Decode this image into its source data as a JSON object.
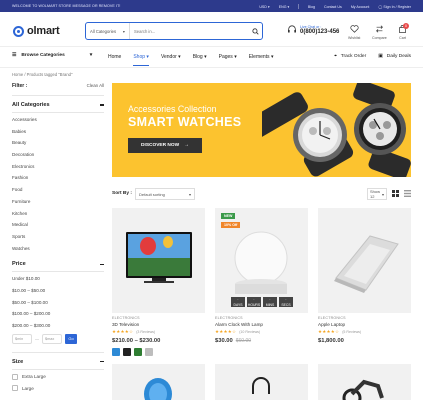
{
  "topbar": {
    "welcome": "WELCOME TO WOLMART STORE MESSAGE OR REMOVE IT!",
    "currency": "USD",
    "language": "ENG",
    "links": [
      "Blog",
      "Contact Us",
      "My Account"
    ],
    "signin": "Sign In / Register"
  },
  "header": {
    "logo": "olmart",
    "search": {
      "category": "All Categories",
      "placeholder": "Search in..."
    },
    "live_chat": "Live Chat or :",
    "phone": "0(800)123-456",
    "wishlist": "Wishlist",
    "compare": "Compare",
    "cart": "Cart",
    "cart_count": "0"
  },
  "nav": {
    "browse": "Browse Categories",
    "items": [
      "Home",
      "Shop",
      "Vendor",
      "Blog",
      "Pages",
      "Elements"
    ],
    "track_order": "Track Order",
    "daily_deals": "Daily Deals"
  },
  "breadcrumb": "Home  /  Products tagged \"Brand\"",
  "sidebar": {
    "filter": "Filter :",
    "clear_all": "Clean All",
    "categories_title": "All Categories",
    "categories": [
      "Accessories",
      "Babies",
      "Beauty",
      "Decoration",
      "Electronics",
      "Fashion",
      "Food",
      "Furniture",
      "Kitchen",
      "Medical",
      "Sports",
      "Watches"
    ],
    "price_title": "Price",
    "prices": [
      "Under $10.00",
      "$10.00 – $50.00",
      "$50.00 – $100.00",
      "$100.00 – $200.00",
      "$200.00 – $300.00"
    ],
    "min_placeholder": "$min",
    "max_placeholder": "$max",
    "go": "Go",
    "size_title": "Size",
    "sizes": [
      "Extra Large",
      "Large"
    ]
  },
  "banner": {
    "subtitle": "Accessories Collection",
    "title": "SMART WATCHES",
    "cta": "DISCOVER NOW"
  },
  "toolbar": {
    "sort_by": "Sort By :",
    "sort_value": "Default sorting",
    "show_value": "Show 12"
  },
  "products": [
    {
      "category": "ELECTRONICS",
      "title": "3D Television",
      "reviews": "(3 Reviews)",
      "price": "$210.00 – $230.00",
      "old_price": ""
    },
    {
      "category": "ELECTRONICS",
      "title": "Alarm Clock With Lamp",
      "reviews": "(10 Reviews)",
      "price": "$30.00",
      "old_price": "$60.00",
      "badge_new": "NEW",
      "badge_sale": "10% Off",
      "countdown": [
        "DAYS",
        "HOURS",
        "MINS",
        "SECS"
      ]
    },
    {
      "category": "ELECTRONICS",
      "title": "Apple Laptop",
      "reviews": "(5 Reviews)",
      "price": "$1,800.00",
      "old_price": ""
    }
  ],
  "colors": {
    "primary": "#2d66d6",
    "banner": "#fcc32f",
    "swatches": [
      "#2d8ad6",
      "#222222",
      "#2e7d32",
      "#bdbdbd"
    ]
  }
}
